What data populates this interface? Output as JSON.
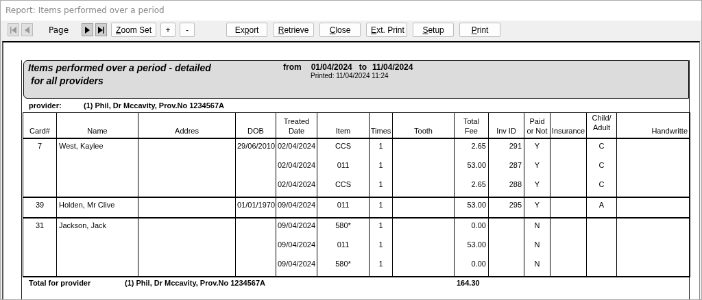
{
  "window": {
    "title": "Report: Items performed over a period"
  },
  "toolbar": {
    "nav_first": {
      "disabled": true
    },
    "nav_prev": {
      "disabled": true
    },
    "page_label": "Page",
    "nav_next": {
      "disabled": false
    },
    "nav_last": {
      "disabled": false
    },
    "zoom_buttons": [
      {
        "key": "Z",
        "post": "oom Set"
      },
      {
        "post": "+"
      },
      {
        "post": "-"
      }
    ],
    "action_buttons": [
      {
        "pre": "Ex",
        "key": "p",
        "post": "ort"
      },
      {
        "key": "R",
        "post": "etrieve"
      },
      {
        "key": "C",
        "post": "lose"
      },
      {
        "key": "E",
        "post": "xt. Print"
      },
      {
        "key": "S",
        "post": "etup"
      },
      {
        "key": "P",
        "post": "rint"
      }
    ]
  },
  "report": {
    "title": "Items performed over a period - detailed",
    "subtitle": "for all providers",
    "from_label": "from",
    "from_date": "01/04/2024",
    "to_label": "to",
    "to_date": "11/04/2024",
    "printed": "Printed: 11/04/2024 11:24",
    "provider_label": "provider:",
    "provider": "(1) Phil, Dr Mccavity, Prov.No 1234567A",
    "columns": [
      [
        "Card#"
      ],
      [
        "Name"
      ],
      [
        "Addres"
      ],
      [
        "DOB"
      ],
      [
        "Treated",
        "Date"
      ],
      [
        "Item"
      ],
      [
        "Times"
      ],
      [
        "Tooth"
      ],
      [
        "Total",
        "Fee"
      ],
      [
        "Inv ID"
      ],
      [
        "Paid",
        "or Not"
      ],
      [
        "Insurance"
      ],
      [
        "Child/",
        "Adult"
      ],
      [
        "Handwritte"
      ]
    ],
    "groups": [
      {
        "card": "7",
        "name": "West, Kaylee",
        "dob": "29/06/2010",
        "items": [
          {
            "date": "02/04/2024",
            "item": "CCS",
            "times": "1",
            "fee": "2.65",
            "inv_id": "291",
            "paid": "Y",
            "child_adult": "C"
          },
          {
            "date": "02/04/2024",
            "item": "011",
            "times": "1",
            "fee": "53.00",
            "inv_id": "287",
            "paid": "Y",
            "child_adult": "C"
          },
          {
            "date": "02/04/2024",
            "item": "CCS",
            "times": "1",
            "fee": "2.65",
            "inv_id": "288",
            "paid": "Y",
            "child_adult": "C"
          }
        ]
      },
      {
        "card": "39",
        "name": "Holden, Mr Clive",
        "dob": "01/01/1970",
        "items": [
          {
            "date": "09/04/2024",
            "item": "011",
            "times": "1",
            "fee": "53.00",
            "inv_id": "295",
            "paid": "Y",
            "child_adult": "A"
          }
        ]
      },
      {
        "card": "31",
        "name": "Jackson, Jack",
        "items": [
          {
            "date": "09/04/2024",
            "item": "580*",
            "times": "1",
            "fee": "0.00",
            "paid": "N"
          },
          {
            "date": "09/04/2024",
            "item": "011",
            "times": "1",
            "fee": "53.00",
            "paid": "N"
          },
          {
            "date": "09/04/2024",
            "item": "580*",
            "times": "1",
            "fee": "0.00",
            "paid": "N"
          }
        ]
      }
    ],
    "total_label": "Total  for provider",
    "total_provider": "(1) Phil, Dr Mccavity, Prov.No 1234567A",
    "total_fee": "164.30"
  }
}
